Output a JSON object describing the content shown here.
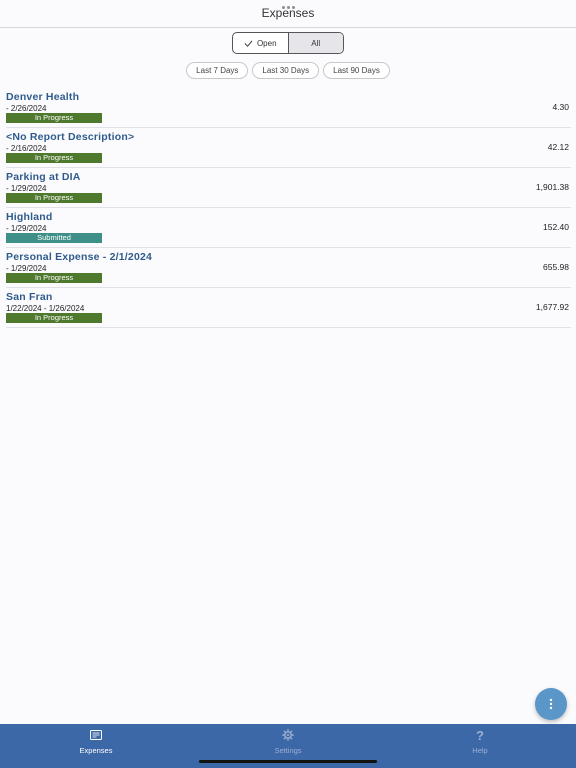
{
  "header": {
    "title": "Expenses"
  },
  "segment": {
    "open_label": "Open",
    "all_label": "All"
  },
  "filters": [
    "Last 7 Days",
    "Last 30 Days",
    "Last 90 Days"
  ],
  "reports": [
    {
      "title": "Denver Health",
      "date": " - 2/26/2024",
      "status": "In Progress",
      "status_color": "#4f7a2e",
      "amount": "4.30"
    },
    {
      "title": "<No Report Description>",
      "date": " - 2/16/2024",
      "status": "In Progress",
      "status_color": "#4f7a2e",
      "amount": "42.12"
    },
    {
      "title": "Parking at DIA",
      "date": " - 1/29/2024",
      "status": "In Progress",
      "status_color": "#4f7a2e",
      "amount": "1,901.38"
    },
    {
      "title": "Highland",
      "date": " - 1/29/2024",
      "status": "Submitted",
      "status_color": "#3d8f88",
      "amount": "152.40"
    },
    {
      "title": "Personal Expense - 2/1/2024",
      "date": " - 1/29/2024",
      "status": "In Progress",
      "status_color": "#4f7a2e",
      "amount": "655.98"
    },
    {
      "title": "San Fran",
      "date": "1/22/2024 - 1/26/2024",
      "status": "In Progress",
      "status_color": "#4f7a2e",
      "amount": "1,677.92"
    }
  ],
  "fab": {
    "icon": "more-vertical-icon"
  },
  "tabs": [
    {
      "label": "Expenses",
      "icon": "receipt-icon",
      "active": true
    },
    {
      "label": "Settings",
      "icon": "gear-icon",
      "active": false
    },
    {
      "label": "Help",
      "icon": "help-icon",
      "active": false
    }
  ],
  "colors": {
    "accent": "#3d68a8",
    "title_blue": "#2f5b8c",
    "fab": "#5b96c9"
  }
}
